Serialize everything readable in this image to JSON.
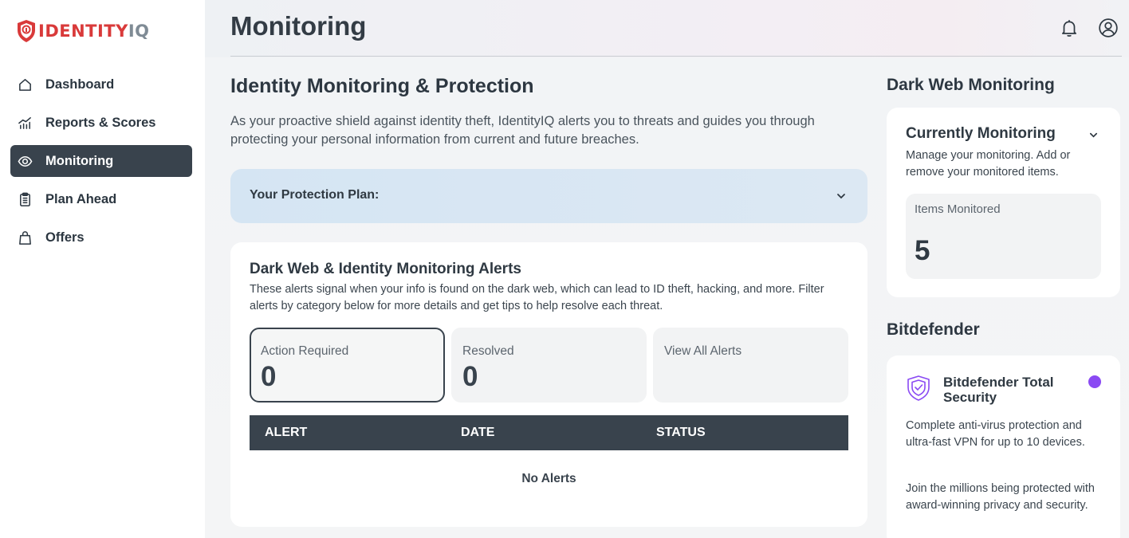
{
  "brand": {
    "logo_identity": "IDENTITY",
    "logo_iq": "IQ",
    "accent": "#d93a3a"
  },
  "sidebar": {
    "items": [
      {
        "label": "Dashboard",
        "icon": "home-icon",
        "active": false
      },
      {
        "label": "Reports & Scores",
        "icon": "chart-icon",
        "active": false
      },
      {
        "label": "Monitoring",
        "icon": "eye-icon",
        "active": true
      },
      {
        "label": "Plan Ahead",
        "icon": "clipboard-icon",
        "active": false
      },
      {
        "label": "Offers",
        "icon": "bag-icon",
        "active": false
      }
    ]
  },
  "header": {
    "title": "Monitoring",
    "icons": [
      "bell-icon",
      "user-circle-icon"
    ]
  },
  "main": {
    "section_title": "Identity Monitoring & Protection",
    "intro": "As your proactive shield against identity theft, IdentityIQ alerts you to threats and guides you through protecting your personal information from current and future breaches.",
    "plan_label": "Your Protection Plan:",
    "alerts": {
      "title": "Dark Web & Identity Monitoring Alerts",
      "description": "These alerts signal when your info is found on the dark web, which can lead to ID theft, hacking, and more. Filter alerts by category below for more details and get tips to help resolve each threat.",
      "stats": [
        {
          "label": "Action Required",
          "value": "0",
          "selected": true
        },
        {
          "label": "Resolved",
          "value": "0",
          "selected": false
        },
        {
          "label": "View All Alerts",
          "value": "",
          "selected": false
        }
      ],
      "columns": [
        "ALERT",
        "DATE",
        "STATUS"
      ],
      "empty_text": "No Alerts"
    }
  },
  "right": {
    "dark_web_title": "Dark Web Monitoring",
    "monitoring": {
      "heading": "Currently Monitoring",
      "description": "Manage your monitoring. Add or remove your monitored items.",
      "items_label": "Items Monitored",
      "items_value": "5"
    },
    "bitdefender_title": "Bitdefender",
    "bitdefender": {
      "name": "Bitdefender Total Security",
      "p1": "Complete anti-virus protection and ultra-fast VPN for up to 10 devices.",
      "p2": "Join the millions being protected with award-winning privacy and security.",
      "dot_color": "#8a4af3"
    }
  }
}
